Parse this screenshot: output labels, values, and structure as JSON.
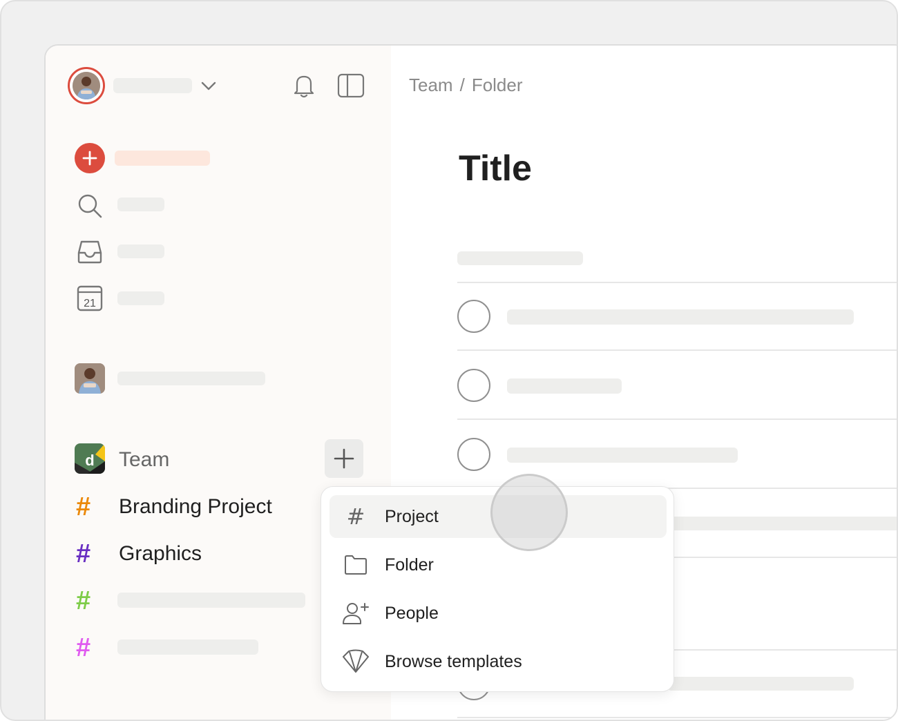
{
  "breadcrumb": {
    "team": "Team",
    "separator": "/",
    "folder": "Folder"
  },
  "page": {
    "title": "Title"
  },
  "sidebar": {
    "team_label": "Team",
    "team_logo_letter": "d",
    "projects": [
      {
        "name": "Branding Project",
        "hash": "#",
        "color": "#eb8909"
      },
      {
        "name": "Graphics",
        "hash": "#",
        "color": "#692fc2"
      },
      {
        "name": "",
        "hash": "#",
        "color": "#7ecc49"
      },
      {
        "name": "",
        "hash": "#",
        "color": "#e05cf0"
      }
    ]
  },
  "menu": {
    "items": [
      {
        "label": "Project",
        "icon": "hash-icon"
      },
      {
        "label": "Folder",
        "icon": "folder-icon"
      },
      {
        "label": "People",
        "icon": "add-person-icon"
      },
      {
        "label": "Browse templates",
        "icon": "templates-icon"
      }
    ],
    "project_hash": "#"
  },
  "colors": {
    "accent": "#dc4c3e",
    "add_placeholder": "#fde7dd",
    "placeholder": "#eeeeec"
  }
}
